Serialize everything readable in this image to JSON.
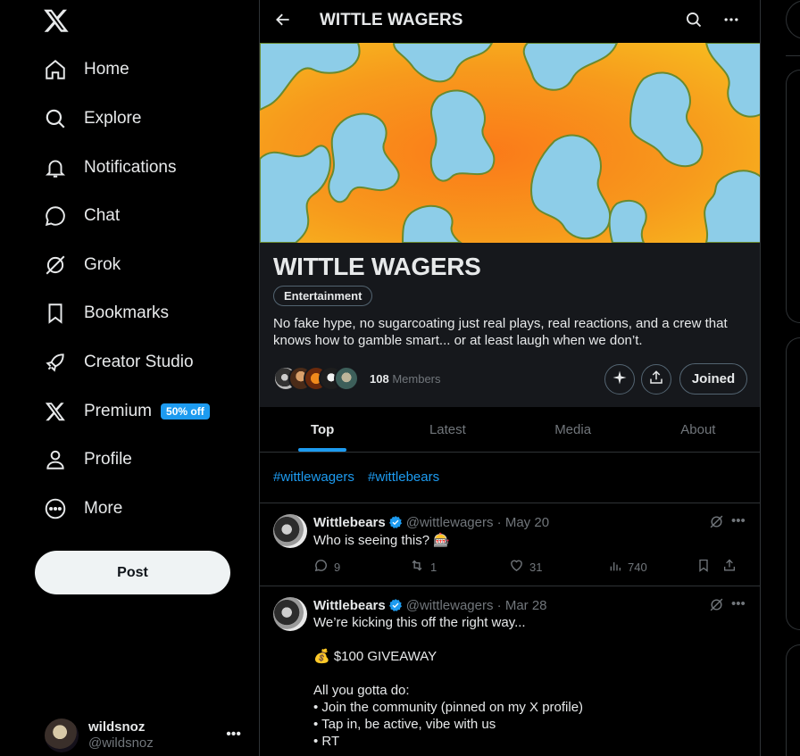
{
  "nav": {
    "items": [
      {
        "label": "Home"
      },
      {
        "label": "Explore"
      },
      {
        "label": "Notifications"
      },
      {
        "label": "Chat"
      },
      {
        "label": "Grok"
      },
      {
        "label": "Bookmarks"
      },
      {
        "label": "Creator Studio"
      },
      {
        "label": "Premium",
        "badge": "50% off"
      },
      {
        "label": "Profile"
      },
      {
        "label": "More"
      }
    ],
    "post_label": "Post"
  },
  "account": {
    "name": "wildsnoz",
    "handle": "@wildsnoz"
  },
  "header": {
    "title": "WITTLE WAGERS"
  },
  "community": {
    "name": "WITTLE WAGERS",
    "category": "Entertainment",
    "description": "No fake hype, no sugarcoating just real plays, real reactions, and a crew that knows how to gamble smart... or at least laugh when we don’t.",
    "member_count": "108",
    "members_label": "Members",
    "joined_label": "Joined"
  },
  "tabs": [
    {
      "label": "Top",
      "active": true
    },
    {
      "label": "Latest"
    },
    {
      "label": "Media"
    },
    {
      "label": "About"
    }
  ],
  "hashtags": [
    "#wittlewagers",
    "#wittlebears"
  ],
  "tweets": [
    {
      "name": "Wittlebears",
      "handle": "@wittlewagers",
      "date": "May 20",
      "text": "Who is seeing this? 🎰",
      "replies": "9",
      "reposts": "1",
      "likes": "31",
      "views": "740"
    },
    {
      "name": "Wittlebears",
      "handle": "@wittlewagers",
      "date": "Mar 28",
      "lines": [
        "We’re kicking this off the right way...",
        "",
        "💰 $100 GIVEAWAY",
        "",
        "All you gotta do:",
        "• Join the community (pinned on my X profile)",
        "• Tap in, be active, vibe with us",
        "• RT"
      ]
    }
  ],
  "colors": {
    "accent": "#1d9bf0",
    "background": "#000000",
    "card": "#16181c",
    "border": "#2f3336",
    "muted": "#71767b"
  }
}
